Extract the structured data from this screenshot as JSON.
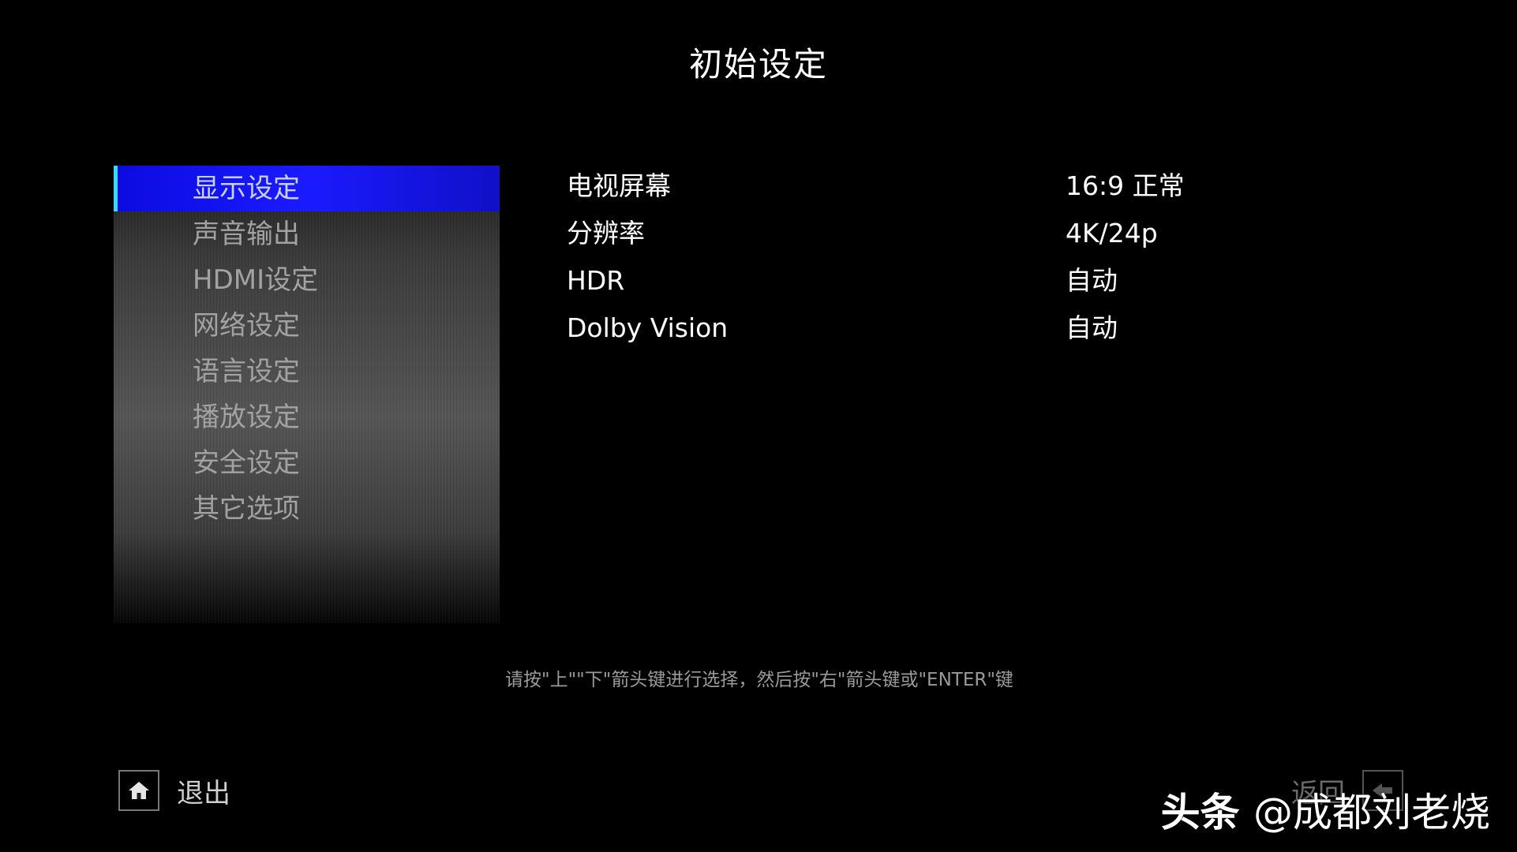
{
  "header": {
    "title": "初始设定"
  },
  "menu": {
    "items": [
      {
        "label": "显示设定",
        "selected": true
      },
      {
        "label": "声音输出",
        "selected": false
      },
      {
        "label": "HDMI设定",
        "selected": false
      },
      {
        "label": "网络设定",
        "selected": false
      },
      {
        "label": "语言设定",
        "selected": false
      },
      {
        "label": "播放设定",
        "selected": false
      },
      {
        "label": "安全设定",
        "selected": false
      },
      {
        "label": "其它选项",
        "selected": false
      }
    ]
  },
  "settings": {
    "rows": [
      {
        "label": "电视屏幕",
        "value": "16:9 正常"
      },
      {
        "label": "分辨率",
        "value": "4K/24p"
      },
      {
        "label": "HDR",
        "value": "自动"
      },
      {
        "label": "Dolby Vision",
        "value": "自动"
      }
    ]
  },
  "hint": {
    "text": "请按\"上\"\"下\"箭头键进行选择，然后按\"右\"箭头键或\"ENTER\"键"
  },
  "footer": {
    "exit_label": "退出",
    "exit_icon": "home-icon",
    "back_label": "返回",
    "back_icon": "back-arrow-icon"
  },
  "watermark": {
    "brand": "头条",
    "handle": "@成都刘老烧"
  },
  "colors": {
    "selected_bg": "#1a1aff",
    "selected_marker": "#3ad7ff",
    "menu_text": "#a2a2a2",
    "background": "#000000"
  }
}
